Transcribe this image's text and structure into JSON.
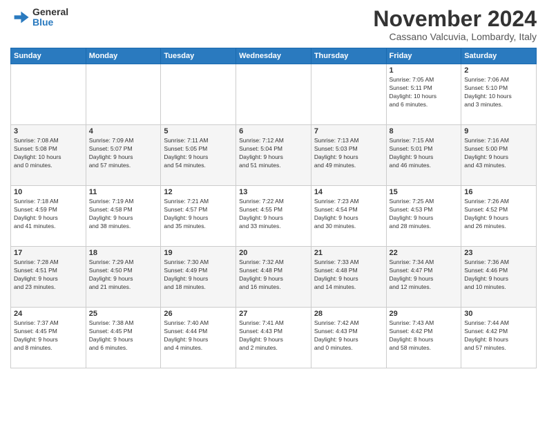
{
  "logo": {
    "general": "General",
    "blue": "Blue"
  },
  "header": {
    "month": "November 2024",
    "location": "Cassano Valcuvia, Lombardy, Italy"
  },
  "weekdays": [
    "Sunday",
    "Monday",
    "Tuesday",
    "Wednesday",
    "Thursday",
    "Friday",
    "Saturday"
  ],
  "weeks": [
    [
      {
        "day": "",
        "info": ""
      },
      {
        "day": "",
        "info": ""
      },
      {
        "day": "",
        "info": ""
      },
      {
        "day": "",
        "info": ""
      },
      {
        "day": "",
        "info": ""
      },
      {
        "day": "1",
        "info": "Sunrise: 7:05 AM\nSunset: 5:11 PM\nDaylight: 10 hours\nand 6 minutes."
      },
      {
        "day": "2",
        "info": "Sunrise: 7:06 AM\nSunset: 5:10 PM\nDaylight: 10 hours\nand 3 minutes."
      }
    ],
    [
      {
        "day": "3",
        "info": "Sunrise: 7:08 AM\nSunset: 5:08 PM\nDaylight: 10 hours\nand 0 minutes."
      },
      {
        "day": "4",
        "info": "Sunrise: 7:09 AM\nSunset: 5:07 PM\nDaylight: 9 hours\nand 57 minutes."
      },
      {
        "day": "5",
        "info": "Sunrise: 7:11 AM\nSunset: 5:05 PM\nDaylight: 9 hours\nand 54 minutes."
      },
      {
        "day": "6",
        "info": "Sunrise: 7:12 AM\nSunset: 5:04 PM\nDaylight: 9 hours\nand 51 minutes."
      },
      {
        "day": "7",
        "info": "Sunrise: 7:13 AM\nSunset: 5:03 PM\nDaylight: 9 hours\nand 49 minutes."
      },
      {
        "day": "8",
        "info": "Sunrise: 7:15 AM\nSunset: 5:01 PM\nDaylight: 9 hours\nand 46 minutes."
      },
      {
        "day": "9",
        "info": "Sunrise: 7:16 AM\nSunset: 5:00 PM\nDaylight: 9 hours\nand 43 minutes."
      }
    ],
    [
      {
        "day": "10",
        "info": "Sunrise: 7:18 AM\nSunset: 4:59 PM\nDaylight: 9 hours\nand 41 minutes."
      },
      {
        "day": "11",
        "info": "Sunrise: 7:19 AM\nSunset: 4:58 PM\nDaylight: 9 hours\nand 38 minutes."
      },
      {
        "day": "12",
        "info": "Sunrise: 7:21 AM\nSunset: 4:57 PM\nDaylight: 9 hours\nand 35 minutes."
      },
      {
        "day": "13",
        "info": "Sunrise: 7:22 AM\nSunset: 4:55 PM\nDaylight: 9 hours\nand 33 minutes."
      },
      {
        "day": "14",
        "info": "Sunrise: 7:23 AM\nSunset: 4:54 PM\nDaylight: 9 hours\nand 30 minutes."
      },
      {
        "day": "15",
        "info": "Sunrise: 7:25 AM\nSunset: 4:53 PM\nDaylight: 9 hours\nand 28 minutes."
      },
      {
        "day": "16",
        "info": "Sunrise: 7:26 AM\nSunset: 4:52 PM\nDaylight: 9 hours\nand 26 minutes."
      }
    ],
    [
      {
        "day": "17",
        "info": "Sunrise: 7:28 AM\nSunset: 4:51 PM\nDaylight: 9 hours\nand 23 minutes."
      },
      {
        "day": "18",
        "info": "Sunrise: 7:29 AM\nSunset: 4:50 PM\nDaylight: 9 hours\nand 21 minutes."
      },
      {
        "day": "19",
        "info": "Sunrise: 7:30 AM\nSunset: 4:49 PM\nDaylight: 9 hours\nand 18 minutes."
      },
      {
        "day": "20",
        "info": "Sunrise: 7:32 AM\nSunset: 4:48 PM\nDaylight: 9 hours\nand 16 minutes."
      },
      {
        "day": "21",
        "info": "Sunrise: 7:33 AM\nSunset: 4:48 PM\nDaylight: 9 hours\nand 14 minutes."
      },
      {
        "day": "22",
        "info": "Sunrise: 7:34 AM\nSunset: 4:47 PM\nDaylight: 9 hours\nand 12 minutes."
      },
      {
        "day": "23",
        "info": "Sunrise: 7:36 AM\nSunset: 4:46 PM\nDaylight: 9 hours\nand 10 minutes."
      }
    ],
    [
      {
        "day": "24",
        "info": "Sunrise: 7:37 AM\nSunset: 4:45 PM\nDaylight: 9 hours\nand 8 minutes."
      },
      {
        "day": "25",
        "info": "Sunrise: 7:38 AM\nSunset: 4:45 PM\nDaylight: 9 hours\nand 6 minutes."
      },
      {
        "day": "26",
        "info": "Sunrise: 7:40 AM\nSunset: 4:44 PM\nDaylight: 9 hours\nand 4 minutes."
      },
      {
        "day": "27",
        "info": "Sunrise: 7:41 AM\nSunset: 4:43 PM\nDaylight: 9 hours\nand 2 minutes."
      },
      {
        "day": "28",
        "info": "Sunrise: 7:42 AM\nSunset: 4:43 PM\nDaylight: 9 hours\nand 0 minutes."
      },
      {
        "day": "29",
        "info": "Sunrise: 7:43 AM\nSunset: 4:42 PM\nDaylight: 8 hours\nand 58 minutes."
      },
      {
        "day": "30",
        "info": "Sunrise: 7:44 AM\nSunset: 4:42 PM\nDaylight: 8 hours\nand 57 minutes."
      }
    ]
  ]
}
